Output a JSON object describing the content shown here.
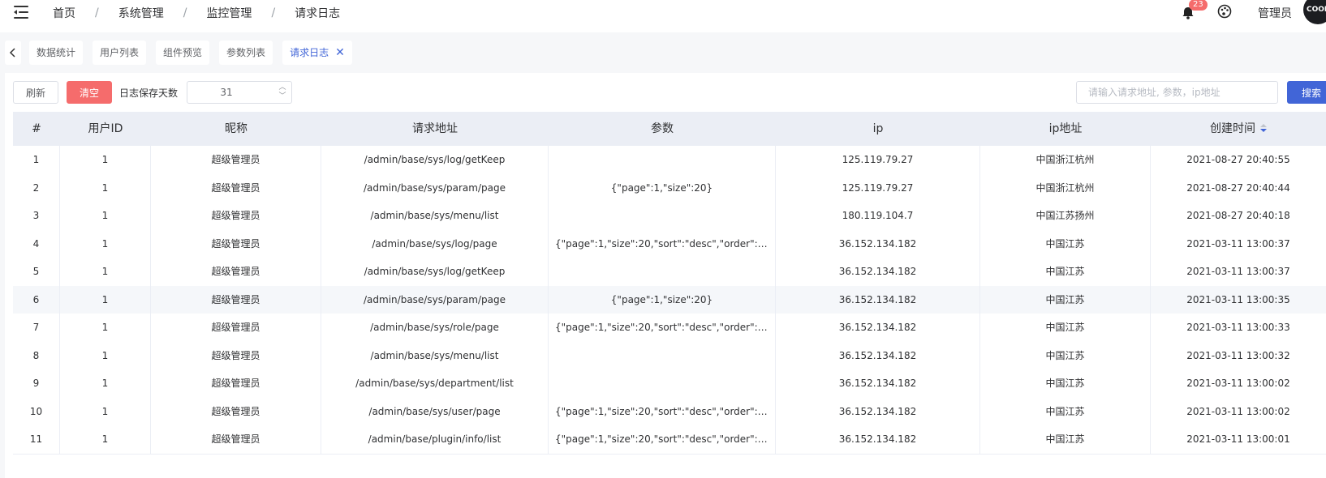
{
  "header": {
    "breadcrumb": [
      "首页",
      "系统管理",
      "监控管理",
      "请求日志"
    ],
    "separator": "/",
    "notification_count": "23",
    "username": "管理员",
    "avatar_text": "COOL"
  },
  "tabs": [
    {
      "label": "数据统计",
      "active": false
    },
    {
      "label": "用户列表",
      "active": false
    },
    {
      "label": "组件预览",
      "active": false
    },
    {
      "label": "参数列表",
      "active": false
    },
    {
      "label": "请求日志",
      "active": true
    }
  ],
  "toolbar": {
    "refresh_label": "刷新",
    "clear_label": "清空",
    "keep_days_label": "日志保存天数",
    "keep_days_value": "31",
    "search_placeholder": "请输入请求地址, 参数，ip地址",
    "search_label": "搜索"
  },
  "table": {
    "columns": [
      "#",
      "用户ID",
      "昵称",
      "请求地址",
      "参数",
      "ip",
      "ip地址",
      "创建时间"
    ],
    "sorted_column": "创建时间",
    "sort_order": "desc",
    "rows": [
      [
        "1",
        "1",
        "超级管理员",
        "/admin/base/sys/log/getKeep",
        "",
        "125.119.79.27",
        "中国浙江杭州",
        "2021-08-27 20:40:55"
      ],
      [
        "2",
        "1",
        "超级管理员",
        "/admin/base/sys/param/page",
        "{\"page\":1,\"size\":20}",
        "125.119.79.27",
        "中国浙江杭州",
        "2021-08-27 20:40:44"
      ],
      [
        "3",
        "1",
        "超级管理员",
        "/admin/base/sys/menu/list",
        "",
        "180.119.104.7",
        "中国江苏扬州",
        "2021-08-27 20:40:18"
      ],
      [
        "4",
        "1",
        "超级管理员",
        "/admin/base/sys/log/page",
        "{\"page\":1,\"size\":20,\"sort\":\"desc\",\"order\":\"creat...",
        "36.152.134.182",
        "中国江苏",
        "2021-03-11 13:00:37"
      ],
      [
        "5",
        "1",
        "超级管理员",
        "/admin/base/sys/log/getKeep",
        "",
        "36.152.134.182",
        "中国江苏",
        "2021-03-11 13:00:37"
      ],
      [
        "6",
        "1",
        "超级管理员",
        "/admin/base/sys/param/page",
        "{\"page\":1,\"size\":20}",
        "36.152.134.182",
        "中国江苏",
        "2021-03-11 13:00:35"
      ],
      [
        "7",
        "1",
        "超级管理员",
        "/admin/base/sys/role/page",
        "{\"page\":1,\"size\":20,\"sort\":\"desc\",\"order\":\"creat...",
        "36.152.134.182",
        "中国江苏",
        "2021-03-11 13:00:33"
      ],
      [
        "8",
        "1",
        "超级管理员",
        "/admin/base/sys/menu/list",
        "",
        "36.152.134.182",
        "中国江苏",
        "2021-03-11 13:00:32"
      ],
      [
        "9",
        "1",
        "超级管理员",
        "/admin/base/sys/department/list",
        "",
        "36.152.134.182",
        "中国江苏",
        "2021-03-11 13:00:02"
      ],
      [
        "10",
        "1",
        "超级管理员",
        "/admin/base/sys/user/page",
        "{\"page\":1,\"size\":20,\"sort\":\"desc\",\"order\":\"creat...",
        "36.152.134.182",
        "中国江苏",
        "2021-03-11 13:00:02"
      ],
      [
        "11",
        "1",
        "超级管理员",
        "/admin/base/plugin/info/list",
        "{\"page\":1,\"size\":20,\"sort\":\"desc\",\"order\":\"creat...",
        "36.152.134.182",
        "中国江苏",
        "2021-03-11 13:00:01"
      ]
    ],
    "highlighted_row": 6
  },
  "colors": {
    "primary": "#4165d7",
    "danger": "#f56c6c",
    "header_bg": "#ebeef5"
  }
}
